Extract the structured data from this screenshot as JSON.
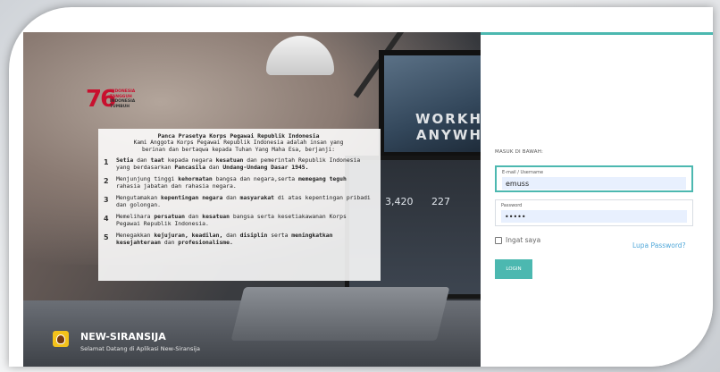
{
  "logo": {
    "number": "76",
    "lines": [
      "INDONESIA",
      "TANGGUH",
      "INDONESIA",
      "TUMBUH"
    ]
  },
  "pledge": {
    "title": "Panca Prasetya Korps Pegawai Republik Indonesia",
    "intro_line1": "Kami Anggota Korps Pegawai Republik Indonesia adalah insan yang",
    "intro_line2": "berinan dan bertaqwa kepada Tuhan Yang Maha Esa, berjanji:",
    "items": [
      {
        "num": "1",
        "text": "Setia dan taat kepada negara kesatuan dan pemerintah Republik Indonesia yang berdasarkan Pancasila dan Undang-Undang Dasar 1945."
      },
      {
        "num": "2",
        "text": "Menjunjung tinggi kehormatan bangsa dan negara,serta memegang teguh rahasia jabatan dan rahasia negara."
      },
      {
        "num": "3",
        "text": "Mengutamakan kepentingan negara dan masyarakat di atas kepentingan pribadi dan golongan."
      },
      {
        "num": "4",
        "text": "Memelihara persatuan dan kesatuan bangsa serta kesetiakawanan Korps Pegawai Republik Indonesia."
      },
      {
        "num": "5",
        "text": "Menegakkan kejujuran, keadilan, dan disiplin serta meningkatkan kesejahteraan dan profesionalisme."
      }
    ]
  },
  "background": {
    "monitor_text_line1": "WORKH",
    "monitor_text_line2": "ANYWH",
    "stat1": "3,420",
    "stat2": "227"
  },
  "brand": {
    "title": "NEW-SIRANSIJA",
    "subtitle": "Selamat Datang di Aplikasi New-Siransija"
  },
  "login": {
    "heading": "MASUK DI BAWAH:",
    "username_label": "E-mail / Username",
    "username_value": "emuss",
    "password_label": "Password",
    "password_value": "•••••",
    "remember_label": "Ingat saya",
    "forgot_label": "Lupa Password?",
    "submit_label": "LOGIN"
  },
  "colors": {
    "accent": "#4cb8b0",
    "link": "#4fa7d9",
    "logo_red": "#c8102e"
  }
}
